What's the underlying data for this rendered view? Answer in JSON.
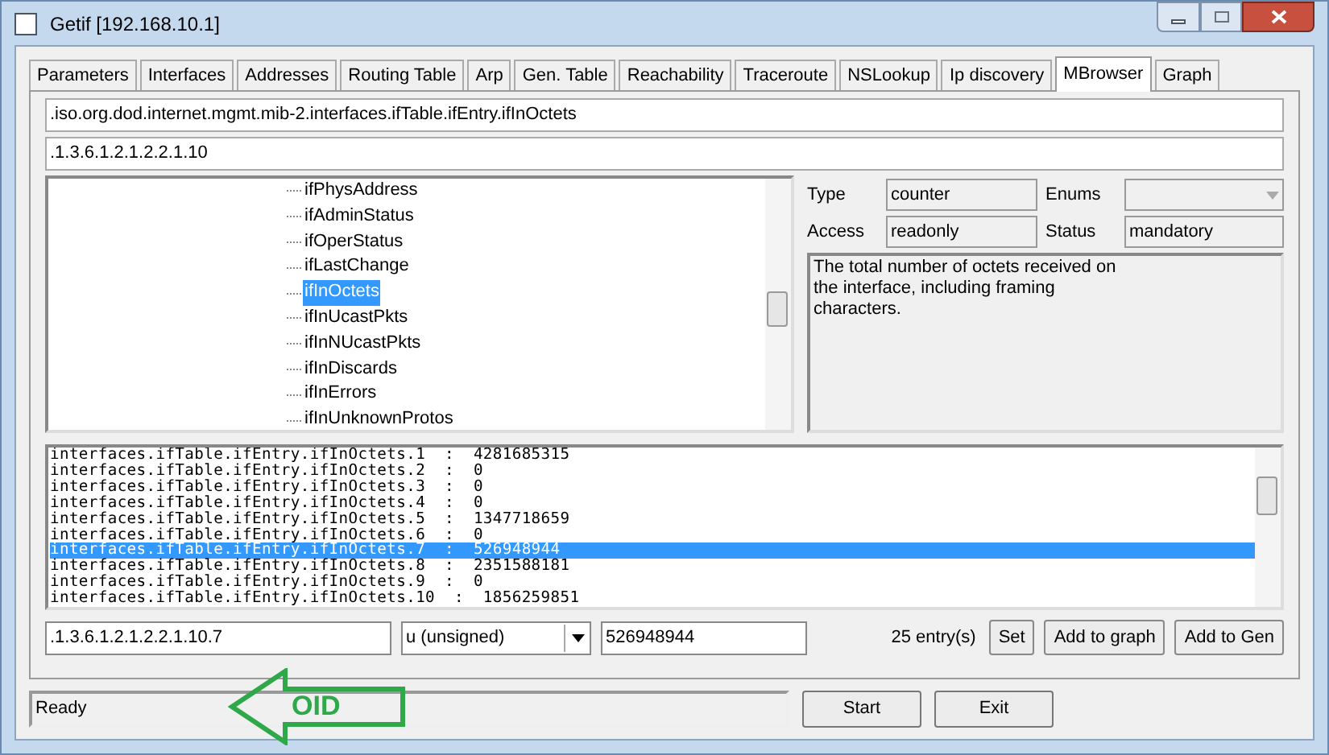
{
  "window": {
    "title": "Getif [192.168.10.1]"
  },
  "tabs": [
    {
      "label": "Parameters",
      "selected": false
    },
    {
      "label": "Interfaces",
      "selected": false
    },
    {
      "label": "Addresses",
      "selected": false
    },
    {
      "label": "Routing Table",
      "selected": false
    },
    {
      "label": "Arp",
      "selected": false
    },
    {
      "label": "Gen. Table",
      "selected": false
    },
    {
      "label": "Reachability",
      "selected": false
    },
    {
      "label": "Traceroute",
      "selected": false
    },
    {
      "label": "NSLookup",
      "selected": false
    },
    {
      "label": "Ip discovery",
      "selected": false
    },
    {
      "label": "MBrowser",
      "selected": true
    },
    {
      "label": "Graph",
      "selected": false
    }
  ],
  "oid_name_field": {
    "value": ".iso.org.dod.internet.mgmt.mib-2.interfaces.ifTable.ifEntry.ifInOctets"
  },
  "oid_number_field": {
    "value": ".1.3.6.1.2.1.2.2.1.10"
  },
  "tree": {
    "items": [
      {
        "label": "ifPhysAddress",
        "selected": false
      },
      {
        "label": "ifAdminStatus",
        "selected": false
      },
      {
        "label": "ifOperStatus",
        "selected": false
      },
      {
        "label": "ifLastChange",
        "selected": false
      },
      {
        "label": "ifInOctets",
        "selected": true
      },
      {
        "label": "ifInUcastPkts",
        "selected": false
      },
      {
        "label": "ifInNUcastPkts",
        "selected": false
      },
      {
        "label": "ifInDiscards",
        "selected": false
      },
      {
        "label": "ifInErrors",
        "selected": false
      },
      {
        "label": "ifInUnknownProtos",
        "selected": false
      }
    ]
  },
  "details": {
    "type_label": "Type",
    "type_value": "counter",
    "enums_label": "Enums",
    "access_label": "Access",
    "access_value": "readonly",
    "status_label": "Status",
    "status_value": "mandatory",
    "description": "The total number of octets received on the interface, including framing characters."
  },
  "results": [
    {
      "line": "interfaces.ifTable.ifEntry.ifInOctets.1  :  4281685315",
      "selected": false
    },
    {
      "line": "interfaces.ifTable.ifEntry.ifInOctets.2  :  0",
      "selected": false
    },
    {
      "line": "interfaces.ifTable.ifEntry.ifInOctets.3  :  0",
      "selected": false
    },
    {
      "line": "interfaces.ifTable.ifEntry.ifInOctets.4  :  0",
      "selected": false
    },
    {
      "line": "interfaces.ifTable.ifEntry.ifInOctets.5  :  1347718659",
      "selected": false
    },
    {
      "line": "interfaces.ifTable.ifEntry.ifInOctets.6  :  0",
      "selected": false
    },
    {
      "line": "interfaces.ifTable.ifEntry.ifInOctets.7  :  526948944",
      "selected": true
    },
    {
      "line": "interfaces.ifTable.ifEntry.ifInOctets.8  :  2351588181",
      "selected": false
    },
    {
      "line": "interfaces.ifTable.ifEntry.ifInOctets.9  :  0",
      "selected": false
    },
    {
      "line": "interfaces.ifTable.ifEntry.ifInOctets.10  :  1856259851",
      "selected": false
    }
  ],
  "set_row": {
    "oid": ".1.3.6.1.2.1.2.2.1.10.7",
    "value_type": "u (unsigned)",
    "value": "526948944",
    "entry_count": "25 entry(s)",
    "buttons": [
      "Set",
      "Add to graph",
      "Add to Gen"
    ]
  },
  "annotation": {
    "label": "OID"
  },
  "status_bar": {
    "text": "Ready"
  },
  "footer_buttons": [
    "Start",
    "Exit"
  ]
}
